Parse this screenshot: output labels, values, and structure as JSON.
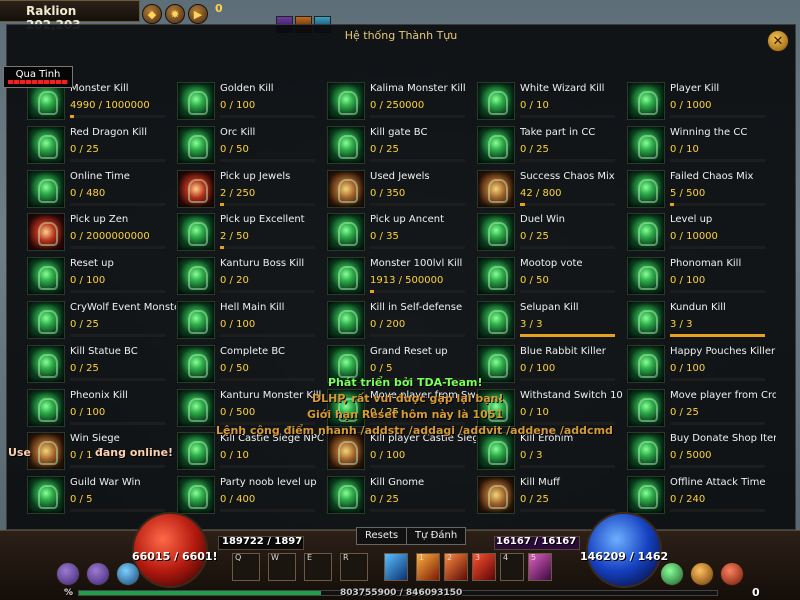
{
  "top_bar": {
    "location": "Raklion 202,203",
    "counter": "0"
  },
  "panel": {
    "title": "Hệ thống Thành Tựu",
    "close_label": "✕"
  },
  "target": {
    "name": "Qua Tinh"
  },
  "achievements": [
    {
      "name": "Monster Kill",
      "progress": "4990 / 1000000",
      "fraction": 0.005,
      "style": "green"
    },
    {
      "name": "Golden Kill",
      "progress": "0 / 100",
      "fraction": 0,
      "style": "green"
    },
    {
      "name": "Kalima Monster Kill",
      "progress": "0 / 250000",
      "fraction": 0,
      "style": "green"
    },
    {
      "name": "White Wizard Kill",
      "progress": "0 / 10",
      "fraction": 0,
      "style": "green"
    },
    {
      "name": "Player Kill",
      "progress": "0 / 1000",
      "fraction": 0,
      "style": "green"
    },
    {
      "name": "Red Dragon Kill",
      "progress": "0 / 25",
      "fraction": 0,
      "style": "green"
    },
    {
      "name": "Orc Kill",
      "progress": "0 / 50",
      "fraction": 0,
      "style": "green"
    },
    {
      "name": "Kill gate BC",
      "progress": "0 / 25",
      "fraction": 0,
      "style": "green"
    },
    {
      "name": "Take part in CC",
      "progress": "0 / 25",
      "fraction": 0,
      "style": "green"
    },
    {
      "name": "Winning the CC",
      "progress": "0 / 10",
      "fraction": 0,
      "style": "green"
    },
    {
      "name": "Online Time",
      "progress": "0 / 480",
      "fraction": 0,
      "style": "green"
    },
    {
      "name": "Pick up Jewels",
      "progress": "2 / 250",
      "fraction": 0.008,
      "style": "red"
    },
    {
      "name": "Used Jewels",
      "progress": "0 / 350",
      "fraction": 0,
      "style": "gold"
    },
    {
      "name": "Success Chaos Mix",
      "progress": "42 / 800",
      "fraction": 0.0525,
      "style": "gold"
    },
    {
      "name": "Failed Chaos Mix",
      "progress": "5 / 500",
      "fraction": 0.01,
      "style": "green"
    },
    {
      "name": "Pick up Zen",
      "progress": "0 / 2000000000",
      "fraction": 0,
      "style": "red"
    },
    {
      "name": "Pick up Excellent",
      "progress": "2 / 50",
      "fraction": 0.04,
      "style": "green"
    },
    {
      "name": "Pick up Ancent",
      "progress": "0 / 35",
      "fraction": 0,
      "style": "green"
    },
    {
      "name": "Duel Win",
      "progress": "0 / 25",
      "fraction": 0,
      "style": "green"
    },
    {
      "name": "Level up",
      "progress": "0 / 10000",
      "fraction": 0,
      "style": "green"
    },
    {
      "name": "Reset up",
      "progress": "0 / 100",
      "fraction": 0,
      "style": "green"
    },
    {
      "name": "Kanturu Boss Kill",
      "progress": "0 / 20",
      "fraction": 0,
      "style": "green"
    },
    {
      "name": "Monster 100lvl Kill",
      "progress": "1913 / 500000",
      "fraction": 0.0038,
      "style": "green"
    },
    {
      "name": "Mootop vote",
      "progress": "0 / 50",
      "fraction": 0,
      "style": "green"
    },
    {
      "name": "Phonoman Kill",
      "progress": "0 / 100",
      "fraction": 0,
      "style": "green"
    },
    {
      "name": "CryWolf Event Monster",
      "progress": "0 / 25",
      "fraction": 0,
      "style": "green"
    },
    {
      "name": "Hell Main Kill",
      "progress": "0 / 100",
      "fraction": 0,
      "style": "green"
    },
    {
      "name": "Kill in Self-defense",
      "progress": "0 / 200",
      "fraction": 0,
      "style": "green"
    },
    {
      "name": "Selupan Kill",
      "progress": "3 / 3",
      "fraction": 1,
      "style": "green"
    },
    {
      "name": "Kundun Kill",
      "progress": "3 / 3",
      "fraction": 1,
      "style": "green"
    },
    {
      "name": "Kill Statue BC",
      "progress": "0 / 25",
      "fraction": 0,
      "style": "green"
    },
    {
      "name": "Complete BC",
      "progress": "0 / 50",
      "fraction": 0,
      "style": "green"
    },
    {
      "name": "Grand Reset up",
      "progress": "0 / 5",
      "fraction": 0,
      "style": "green"
    },
    {
      "name": "Blue Rabbit Killer",
      "progress": "0 / 100",
      "fraction": 0,
      "style": "green"
    },
    {
      "name": "Happy Pouches Killer",
      "progress": "0 / 100",
      "fraction": 0,
      "style": "green"
    },
    {
      "name": "Pheonix Kill",
      "progress": "0 / 100",
      "fraction": 0,
      "style": "green"
    },
    {
      "name": "Kanturu Monster Kill",
      "progress": "0 / 500",
      "fraction": 0,
      "style": "green"
    },
    {
      "name": "Move player from Swamp",
      "progress": "0 / 25",
      "fraction": 0,
      "style": "green"
    },
    {
      "name": "Withstand Switch 10 min",
      "progress": "0 / 10",
      "fraction": 0,
      "style": "green"
    },
    {
      "name": "Move player from Crown",
      "progress": "0 / 25",
      "fraction": 0,
      "style": "green"
    },
    {
      "name": "Win Siege",
      "progress": "0 / 1",
      "fraction": 0,
      "style": "gold"
    },
    {
      "name": "Kill Castle Siege NPC",
      "progress": "0 / 10",
      "fraction": 0,
      "style": "green"
    },
    {
      "name": "Kill player Castle Siege",
      "progress": "0 / 100",
      "fraction": 0,
      "style": "gold"
    },
    {
      "name": "Kill Erohim",
      "progress": "0 / 3",
      "fraction": 0,
      "style": "green"
    },
    {
      "name": "Buy Donate Shop Item",
      "progress": "0 / 5000",
      "fraction": 0,
      "style": "green"
    },
    {
      "name": "Guild War Win",
      "progress": "0 / 5",
      "fraction": 0,
      "style": "green"
    },
    {
      "name": "Party noob level up",
      "progress": "0 / 400",
      "fraction": 0,
      "style": "green"
    },
    {
      "name": "Kill  Gnome",
      "progress": "0 / 25",
      "fraction": 0,
      "style": "green"
    },
    {
      "name": "Kill Muff",
      "progress": "0 / 25",
      "fraction": 0,
      "style": "gold"
    },
    {
      "name": "Offline Attack Time",
      "progress": "0 / 240",
      "fraction": 0,
      "style": "green"
    }
  ],
  "overlay": {
    "line1": "Phát triển bởi TDA-Team!",
    "line2": "DLHP, rất vui được gặp lại bạn!",
    "line3": "Giới hạn Reset hôm này là 1051",
    "line4": "Lệnh cộng điểm nhanh /addstr /addagi /addvit /addene /addcmd",
    "line5": "Use",
    "line6": "đang online!"
  },
  "hud": {
    "hp": "66015 / 6601!",
    "left_value": "189722 / 1897",
    "right_value": "16167 / 16167",
    "mp": "146209 / 1462",
    "tab_resets": "Resets",
    "tab_auto": "Tự Đánh",
    "slot_keys": [
      "Q",
      "W",
      "E",
      "R"
    ],
    "skill_keys": [
      "1",
      "2",
      "3",
      "4",
      "5"
    ],
    "exp_text": "803755900 / 846093150",
    "bottom_counter": "0",
    "exp_fraction": 0.38,
    "percent_label": "%"
  }
}
